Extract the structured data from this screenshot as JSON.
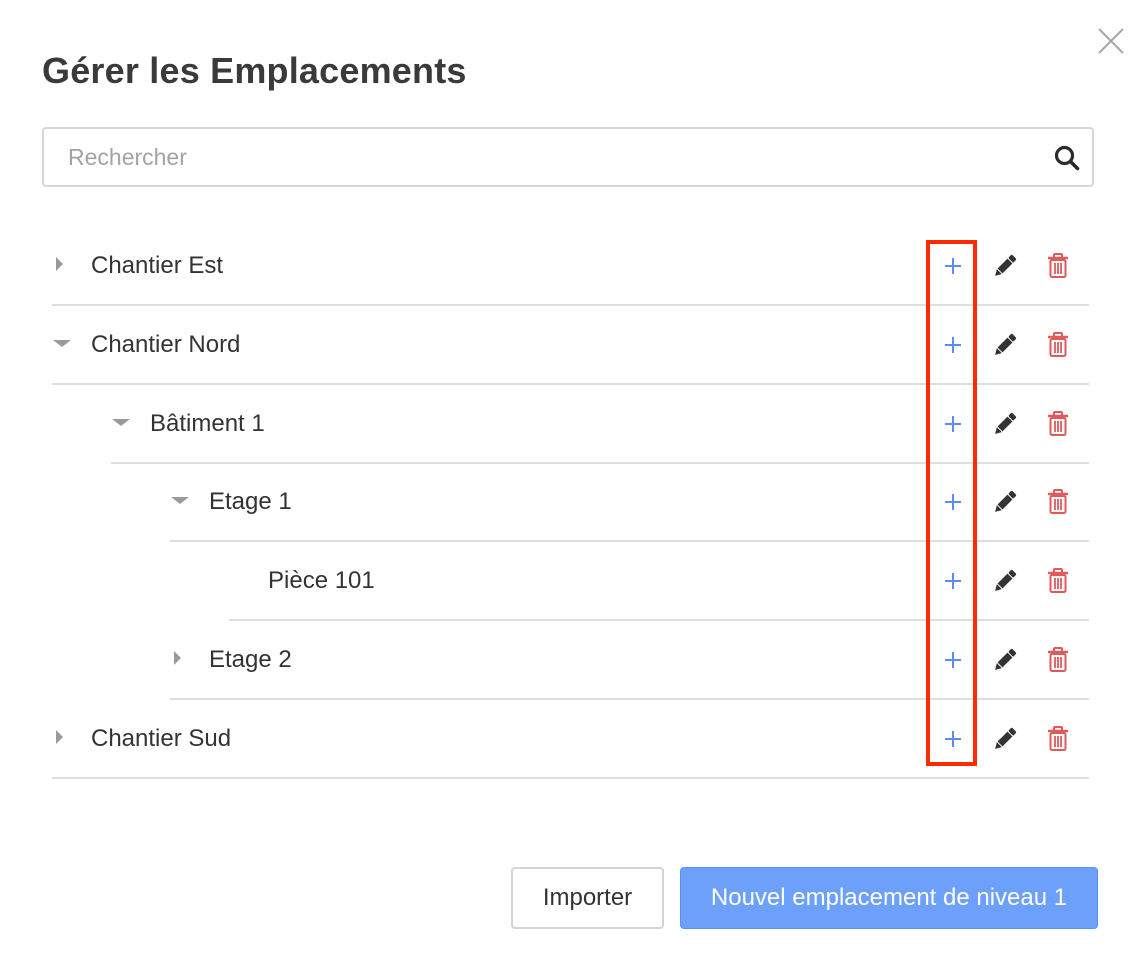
{
  "dialog": {
    "title": "Gérer les Emplacements",
    "close_icon": "close-icon"
  },
  "search": {
    "placeholder": "Rechercher",
    "value": "",
    "icon": "search-icon"
  },
  "tree": {
    "items": [
      {
        "label": "Chantier Est",
        "level": 1,
        "state": "collapsed"
      },
      {
        "label": "Chantier Nord",
        "level": 1,
        "state": "expanded"
      },
      {
        "label": "Bâtiment 1",
        "level": 2,
        "state": "expanded"
      },
      {
        "label": "Etage 1",
        "level": 3,
        "state": "expanded"
      },
      {
        "label": "Pièce 101",
        "level": 4,
        "state": "leaf"
      },
      {
        "label": "Etage 2",
        "level": 3,
        "state": "collapsed"
      },
      {
        "label": "Chantier Sud",
        "level": 1,
        "state": "collapsed"
      }
    ],
    "row_actions": [
      "plus-icon",
      "pencil-icon",
      "trash-icon"
    ]
  },
  "footer": {
    "import_label": "Importer",
    "new_label": "Nouvel emplacement de niveau 1"
  },
  "colors": {
    "add_icon": "#5b8def",
    "edit_icon": "#333333",
    "delete_icon": "#e05a5a",
    "primary_button": "#6da0fa",
    "highlight_box": "#ff2a00"
  }
}
